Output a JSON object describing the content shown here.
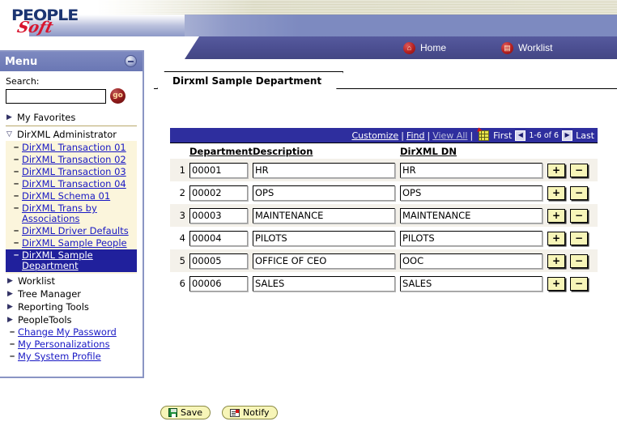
{
  "banner": {
    "logo": {
      "top": "PEOPLE",
      "bottom": "Soft",
      "trademark": "®"
    },
    "nav": [
      {
        "label": "Home",
        "icon": "home-icon"
      },
      {
        "label": "Worklist",
        "icon": "worklist-icon"
      }
    ]
  },
  "sidebar": {
    "title": "Menu",
    "minimize_icon": "minimize-icon",
    "search": {
      "label": "Search:",
      "value": "",
      "placeholder": "",
      "go_label": "go"
    },
    "favorites": {
      "label": "My Favorites",
      "arrow": "▶"
    },
    "administrator": {
      "label": "DirXML Administrator",
      "arrow": "▽"
    },
    "admin_items": [
      {
        "label": "DirXML Transaction 01",
        "selected": false
      },
      {
        "label": "DirXML Transaction 02",
        "selected": false
      },
      {
        "label": "DirXML Transaction 03",
        "selected": false
      },
      {
        "label": "DirXML Transaction 04",
        "selected": false
      },
      {
        "label": "DirXML Schema 01",
        "selected": false
      },
      {
        "label": "DirXML Trans by Associations",
        "selected": false
      },
      {
        "label": "DirXML Driver Defaults",
        "selected": false
      },
      {
        "label": "DirXML Sample People",
        "selected": false
      },
      {
        "label": "DirXML Sample Department",
        "selected": true
      }
    ],
    "folders": [
      {
        "label": "Worklist",
        "arrow": "▶"
      },
      {
        "label": "Tree Manager",
        "arrow": "▶"
      },
      {
        "label": "Reporting Tools",
        "arrow": "▶"
      },
      {
        "label": "PeopleTools",
        "arrow": "▶"
      }
    ],
    "links": [
      {
        "label": "Change My Password"
      },
      {
        "label": "My Personalizations"
      },
      {
        "label": "My System Profile"
      }
    ]
  },
  "main": {
    "tab_label": "Dirxml Sample Department",
    "grid_toolbar": {
      "customize": "Customize",
      "find": "Find",
      "view_all": "View All",
      "download_icon": "spreadsheet-download-icon",
      "first": "First",
      "prev_icon": "◀",
      "range": "1-6 of 6",
      "next_icon": "▶",
      "last": "Last"
    },
    "columns": [
      "Department",
      "Description",
      "DirXML DN"
    ],
    "rows": [
      {
        "n": "1",
        "department": "00001",
        "description": "HR",
        "dn": "HR"
      },
      {
        "n": "2",
        "department": "00002",
        "description": "OPS",
        "dn": "OPS"
      },
      {
        "n": "3",
        "department": "00003",
        "description": "MAINTENANCE",
        "dn": "MAINTENANCE"
      },
      {
        "n": "4",
        "department": "00004",
        "description": "PILOTS",
        "dn": "PILOTS"
      },
      {
        "n": "5",
        "department": "00005",
        "description": "OFFICE OF CEO",
        "dn": "OOC"
      },
      {
        "n": "6",
        "department": "00006",
        "description": "SALES",
        "dn": "SALES"
      }
    ],
    "row_add_label": "+",
    "row_del_label": "−"
  },
  "footer": {
    "save": {
      "label": "Save",
      "icon": "save-disk-icon"
    },
    "notify": {
      "label": "Notify",
      "icon": "notify-note-icon"
    }
  },
  "colors": {
    "banner_blue": "#7d8ac0",
    "nav_bar": "#4b4e94",
    "menu_header": "#6f7cb8",
    "grid_bar": "#2e2e9e",
    "selected_item": "#20209c",
    "link_blue": "#1818c4",
    "button_yellow": "#f7f5b8",
    "group_bg": "#fbf5dc",
    "alt_row": "#f4f1ea"
  }
}
